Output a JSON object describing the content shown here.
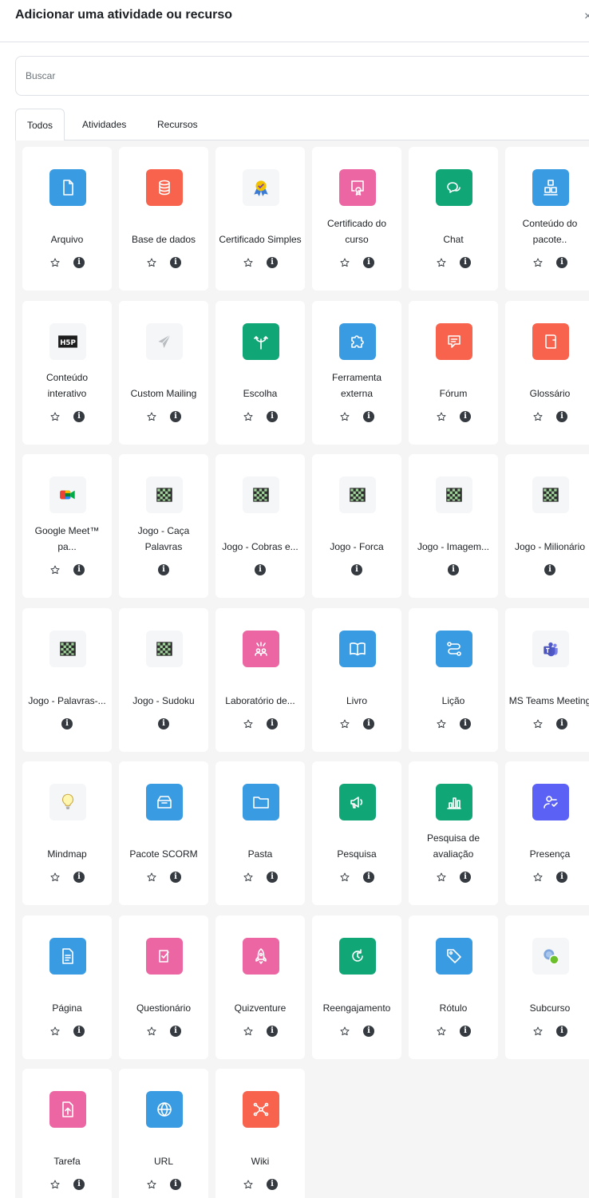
{
  "header": {
    "title": "Adicionar uma atividade ou recurso",
    "close_glyph": "×"
  },
  "search": {
    "placeholder": "Buscar"
  },
  "tabs": [
    {
      "label": "Todos",
      "active": true
    },
    {
      "label": "Atividades",
      "active": false
    },
    {
      "label": "Recursos",
      "active": false
    }
  ],
  "items": [
    {
      "label": "Arquivo",
      "icon": "file-icon",
      "color": "#399be2",
      "star": true
    },
    {
      "label": "Base de dados",
      "icon": "database-icon",
      "color": "#f7634d",
      "star": true
    },
    {
      "label": "Certificado Simples",
      "icon": "award-ribbon-icon",
      "color": "",
      "star": true
    },
    {
      "label": "Certificado do curso",
      "icon": "certificate-icon",
      "color": "#eb66a2",
      "star": true
    },
    {
      "label": "Chat",
      "icon": "chat-icon",
      "color": "#11a676",
      "star": true
    },
    {
      "label": "Conteúdo do pacote..",
      "icon": "package-blocks-icon",
      "color": "#399be2",
      "star": true
    },
    {
      "label": "Conteúdo interativo",
      "icon": "h5p-icon",
      "color": "",
      "star": true
    },
    {
      "label": "Custom Mailing",
      "icon": "paper-plane-icon",
      "color": "",
      "star": true
    },
    {
      "label": "Escolha",
      "icon": "signpost-icon",
      "color": "#11a676",
      "star": true
    },
    {
      "label": "Ferramenta externa",
      "icon": "puzzle-icon",
      "color": "#399be2",
      "star": true
    },
    {
      "label": "Fórum",
      "icon": "forum-icon",
      "color": "#f7634d",
      "star": true
    },
    {
      "label": "Glossário",
      "icon": "glossary-icon",
      "color": "#f7634d",
      "star": true
    },
    {
      "label": "Google Meet™ pa...",
      "icon": "google-meet-icon",
      "color": "",
      "star": true
    },
    {
      "label": "Jogo - Caça Palavras",
      "icon": "game-board-icon",
      "color": "",
      "star": false
    },
    {
      "label": "Jogo - Cobras e...",
      "icon": "game-board-icon",
      "color": "",
      "star": false
    },
    {
      "label": "Jogo - Forca",
      "icon": "game-board-icon",
      "color": "",
      "star": false
    },
    {
      "label": "Jogo - Imagem...",
      "icon": "game-board-icon",
      "color": "",
      "star": false
    },
    {
      "label": "Jogo - Milionário",
      "icon": "game-board-icon",
      "color": "",
      "star": false
    },
    {
      "label": "Jogo - Palavras-...",
      "icon": "game-board-icon",
      "color": "",
      "star": false
    },
    {
      "label": "Jogo - Sudoku",
      "icon": "game-board-icon",
      "color": "",
      "star": false
    },
    {
      "label": "Laboratório de...",
      "icon": "workshop-icon",
      "color": "#eb66a2",
      "star": true
    },
    {
      "label": "Livro",
      "icon": "book-icon",
      "color": "#399be2",
      "star": true
    },
    {
      "label": "Lição",
      "icon": "lesson-path-icon",
      "color": "#399be2",
      "star": true
    },
    {
      "label": "MS Teams Meeting",
      "icon": "teams-icon",
      "color": "",
      "star": true
    },
    {
      "label": "Mindmap",
      "icon": "lightbulb-icon",
      "color": "",
      "star": true
    },
    {
      "label": "Pacote SCORM",
      "icon": "scorm-box-icon",
      "color": "#399be2",
      "star": true
    },
    {
      "label": "Pasta",
      "icon": "folder-icon",
      "color": "#399be2",
      "star": true
    },
    {
      "label": "Pesquisa",
      "icon": "megaphone-icon",
      "color": "#11a676",
      "star": true
    },
    {
      "label": "Pesquisa de avaliação",
      "icon": "bar-chart-icon",
      "color": "#11a676",
      "star": true
    },
    {
      "label": "Presença",
      "icon": "attendance-icon",
      "color": "#5b61f4",
      "star": true
    },
    {
      "label": "Página",
      "icon": "page-icon",
      "color": "#399be2",
      "star": true
    },
    {
      "label": "Questionário",
      "icon": "quiz-check-icon",
      "color": "#eb66a2",
      "star": true
    },
    {
      "label": "Quizventure",
      "icon": "rocket-icon",
      "color": "#eb66a2",
      "star": true
    },
    {
      "label": "Reengajamento",
      "icon": "reengagement-icon",
      "color": "#11a676",
      "star": true
    },
    {
      "label": "Rótulo",
      "icon": "tag-icon",
      "color": "#399be2",
      "star": true
    },
    {
      "label": "Subcurso",
      "icon": "subcourse-icon",
      "color": "",
      "star": true
    },
    {
      "label": "Tarefa",
      "icon": "assignment-upload-icon",
      "color": "#eb66a2",
      "star": true
    },
    {
      "label": "URL",
      "icon": "globe-icon",
      "color": "#399be2",
      "star": true
    },
    {
      "label": "Wiki",
      "icon": "wiki-network-icon",
      "color": "#f7634d",
      "star": true
    }
  ]
}
